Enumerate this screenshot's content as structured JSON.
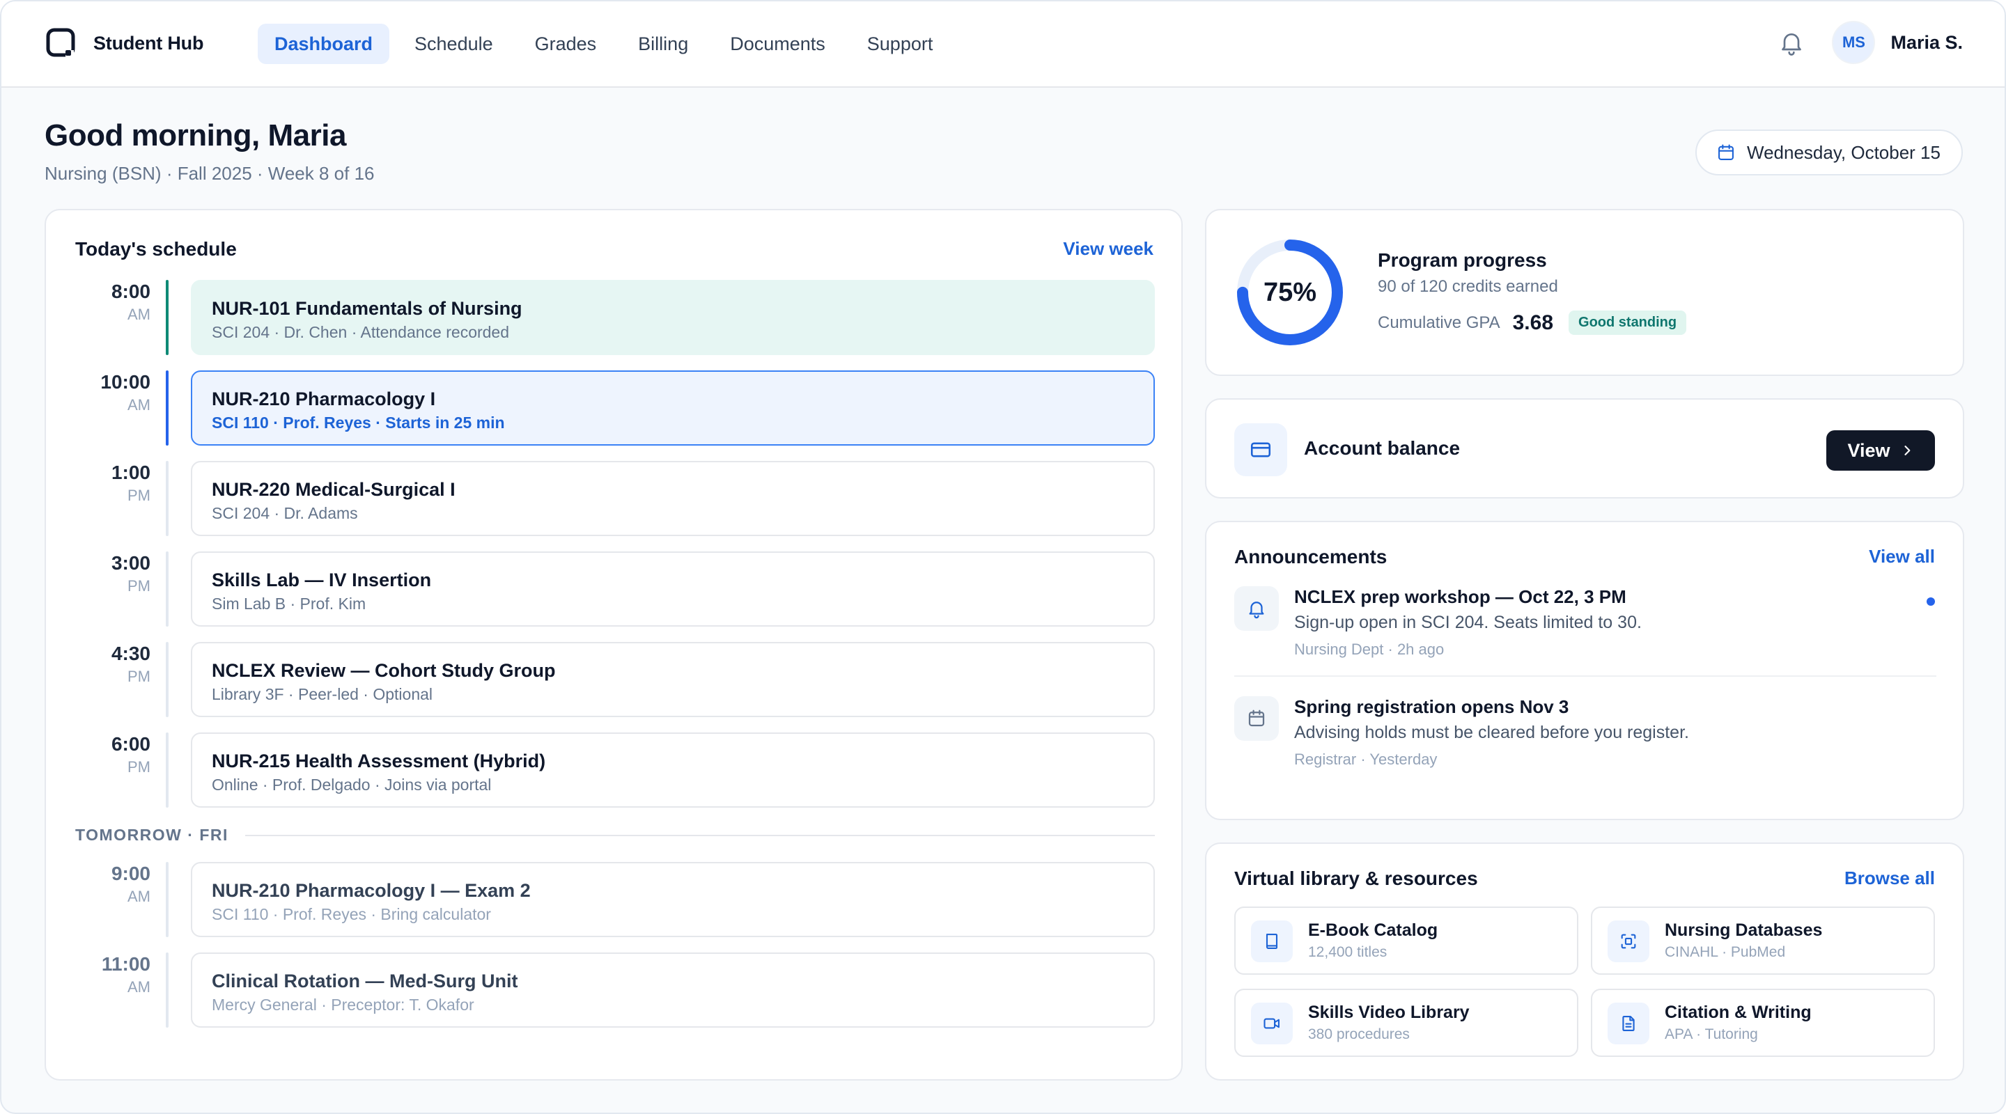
{
  "header": {
    "brand": "Student Hub",
    "nav": [
      "Dashboard",
      "Schedule",
      "Grades",
      "Billing",
      "Documents",
      "Support"
    ],
    "active_tab": "Dashboard",
    "user_initials": "MS",
    "user_name": "Maria S."
  },
  "greeting": {
    "title": "Good morning, Maria",
    "subtitle": "Nursing (BSN) · Fall 2025 · Week 8 of 16",
    "date": "Wednesday, October 15"
  },
  "schedule": {
    "title": "Today's schedule",
    "view_link": "View week",
    "today": [
      {
        "time": "8:00",
        "ampm": "AM",
        "name": "NUR-101 Fundamentals of Nursing",
        "meta": "SCI 204 · Dr. Chen · Attendance recorded",
        "state": "done"
      },
      {
        "time": "10:00",
        "ampm": "AM",
        "name": "NUR-210 Pharmacology I",
        "meta": "SCI 110 · Prof. Reyes · Starts in 25 min",
        "state": "current"
      },
      {
        "time": "1:00",
        "ampm": "PM",
        "name": "NUR-220 Medical-Surgical I",
        "meta": "SCI 204 · Dr. Adams",
        "state": "upcoming"
      },
      {
        "time": "3:00",
        "ampm": "PM",
        "name": "Skills Lab — IV Insertion",
        "meta": "Sim Lab B · Prof. Kim",
        "state": "upcoming"
      },
      {
        "time": "4:30",
        "ampm": "PM",
        "name": "NCLEX Review — Cohort Study Group",
        "meta": "Library 3F · Peer-led · Optional",
        "state": "upcoming"
      },
      {
        "time": "6:00",
        "ampm": "PM",
        "name": "NUR-215 Health Assessment (Hybrid)",
        "meta": "Online · Prof. Delgado · Joins via portal",
        "state": "upcoming"
      }
    ],
    "tomorrow_label": "TOMORROW · FRI",
    "tomorrow": [
      {
        "time": "9:00",
        "ampm": "AM",
        "name": "NUR-210 Pharmacology I — Exam 2",
        "meta": "SCI 110 · Prof. Reyes · Bring calculator"
      },
      {
        "time": "11:00",
        "ampm": "AM",
        "name": "Clinical Rotation — Med-Surg Unit",
        "meta": "Mercy General · Preceptor: T. Okafor"
      }
    ]
  },
  "progress": {
    "percent": 75,
    "percent_label": "75%",
    "title": "Program progress",
    "credits": "90 of 120 credits earned",
    "gpa_label": "Cumulative GPA",
    "gpa": "3.68",
    "standing": "Good standing"
  },
  "balance": {
    "label": "Account balance",
    "button": "View"
  },
  "announcements": {
    "title": "Announcements",
    "view_link": "View all",
    "items": [
      {
        "title": "NCLEX prep workshop — Oct 22, 3 PM",
        "body": "Sign-up open in SCI 204. Seats limited to 30.",
        "meta": "Nursing Dept · 2h ago",
        "icon": "bell-icon",
        "unread": true
      },
      {
        "title": "Spring registration opens Nov 3",
        "body": "Advising holds must be cleared before you register.",
        "meta": "Registrar · Yesterday",
        "icon": "calendar-icon",
        "unread": false
      }
    ]
  },
  "library": {
    "title": "Virtual library & resources",
    "view_link": "Browse all",
    "items": [
      {
        "name": "E-Book Catalog",
        "sub": "12,400 titles",
        "icon": "book-icon"
      },
      {
        "name": "Nursing Databases",
        "sub": "CINAHL · PubMed",
        "icon": "database-scan-icon"
      },
      {
        "name": "Skills Video Library",
        "sub": "380 procedures",
        "icon": "video-icon"
      },
      {
        "name": "Citation & Writing",
        "sub": "APA · Tutoring",
        "icon": "document-icon"
      }
    ]
  },
  "colors": {
    "accent": "#1d63d6",
    "done_bg": "#e6f6f3",
    "done_rail": "#0f8a76",
    "current_rail": "#2563eb"
  }
}
